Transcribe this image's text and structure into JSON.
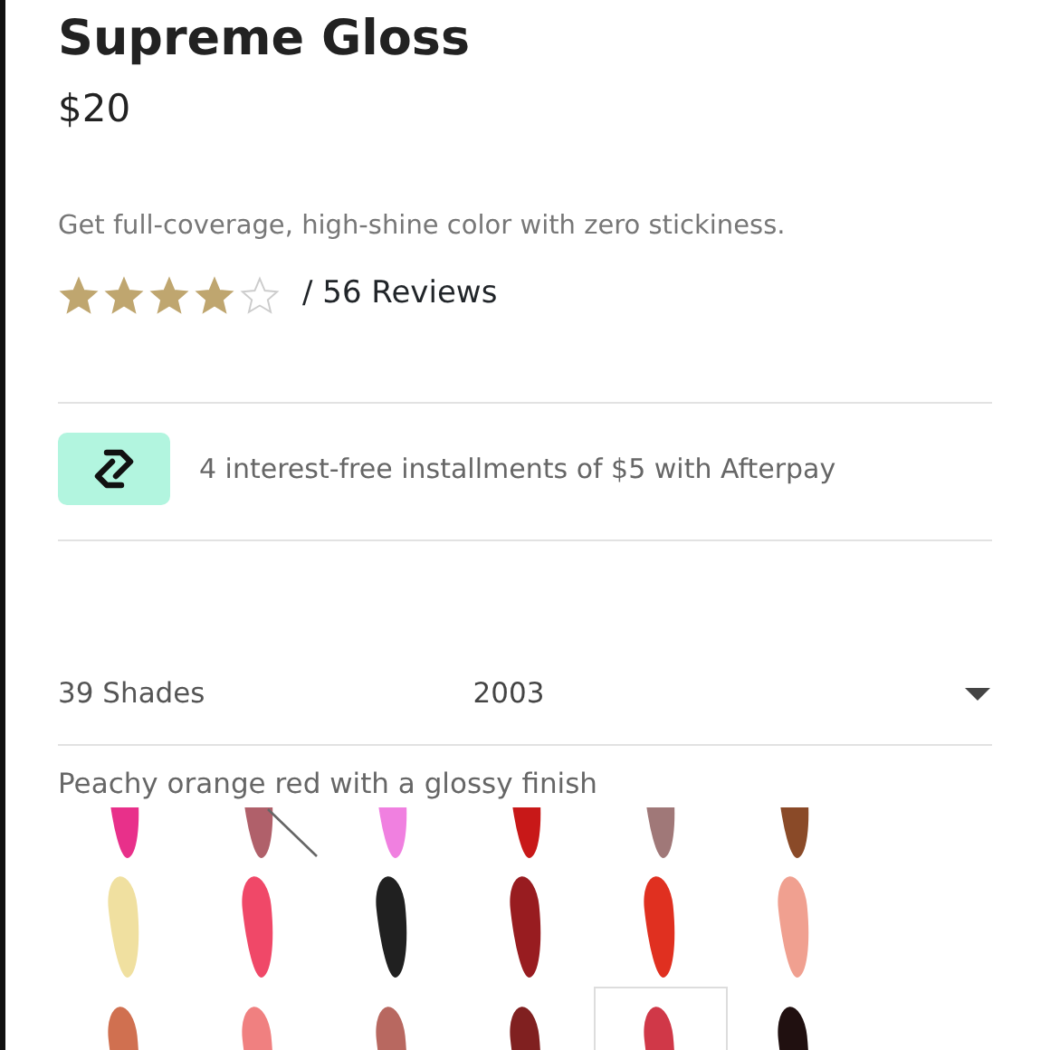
{
  "product": {
    "title": "Supreme Gloss",
    "price": "$20",
    "description": "Get full-coverage, high-shine color with zero stickiness.",
    "stars": 4,
    "reviews": "/ 56 Reviews"
  },
  "afterpay": {
    "text": "4 interest-free installments of $5 with Afterpay"
  },
  "shade_picker": {
    "count": "39 Shades",
    "value": "2003",
    "description": "Peachy orange red with a glossy finish"
  },
  "swatches": [
    {
      "color": "#e8308a",
      "selected": false,
      "unavailable": false
    },
    {
      "color": "#b0606a",
      "selected": false,
      "unavailable": true
    },
    {
      "color": "#f080e0",
      "selected": false,
      "unavailable": false
    },
    {
      "color": "#c81818",
      "selected": false,
      "unavailable": false
    },
    {
      "color": "#a07878",
      "selected": false,
      "unavailable": false
    },
    {
      "color": "#8a4a28",
      "selected": false,
      "unavailable": false
    },
    {
      "color": "#f0e0a0",
      "selected": false,
      "unavailable": false
    },
    {
      "color": "#f04868",
      "selected": false,
      "unavailable": false
    },
    {
      "color": "#202020",
      "selected": false,
      "unavailable": false
    },
    {
      "color": "#981c20",
      "selected": false,
      "unavailable": false
    },
    {
      "color": "#e03020",
      "selected": false,
      "unavailable": false
    },
    {
      "color": "#f0a090",
      "selected": false,
      "unavailable": false
    },
    {
      "color": "#d07050",
      "selected": false,
      "unavailable": false
    },
    {
      "color": "#f08080",
      "selected": false,
      "unavailable": false
    },
    {
      "color": "#b86860",
      "selected": false,
      "unavailable": false
    },
    {
      "color": "#802020",
      "selected": false,
      "unavailable": false
    },
    {
      "color": "#d03848",
      "selected": true,
      "unavailable": false
    },
    {
      "color": "#201010",
      "selected": false,
      "unavailable": false
    }
  ]
}
